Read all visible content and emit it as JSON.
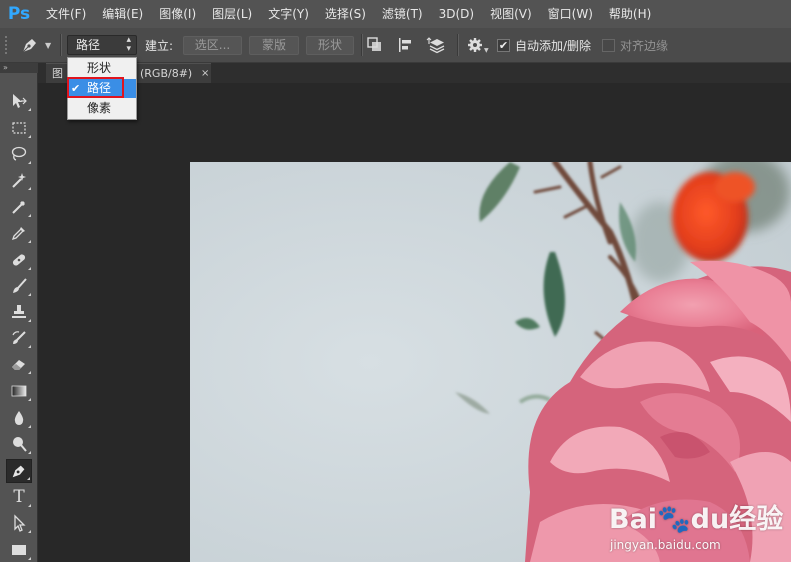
{
  "app": {
    "logo": "Ps"
  },
  "menu": [
    "文件(F)",
    "编辑(E)",
    "图像(I)",
    "图层(L)",
    "文字(Y)",
    "选择(S)",
    "滤镜(T)",
    "3D(D)",
    "视图(V)",
    "窗口(W)",
    "帮助(H)"
  ],
  "options": {
    "mode_value": "路径",
    "build_label": "建立:",
    "selection_btn": "选区...",
    "mask_btn": "蒙版",
    "shape_btn": "形状",
    "auto_add_delete": "自动添加/删除",
    "auto_add_delete_checked": true,
    "align_edges": "对齐边缘",
    "align_edges_checked": false
  },
  "dropdown": {
    "options": [
      "形状",
      "路径",
      "像素"
    ],
    "selected": "路径",
    "check": "✔"
  },
  "document_tab": {
    "title_left": "图",
    "title_right": "(RGB/8#)",
    "close": "×"
  },
  "toolbox": {
    "header": "»",
    "tools": [
      "move-icon",
      "marquee-icon",
      "lasso-icon",
      "magic-wand-icon",
      "crop-icon",
      "eyedropper-icon",
      "healing-brush-icon",
      "brush-icon",
      "clone-stamp-icon",
      "history-brush-icon",
      "eraser-icon",
      "gradient-icon",
      "blur-icon",
      "dodge-icon",
      "pen-icon",
      "type-icon",
      "path-selection-icon",
      "rectangle-icon"
    ],
    "active_tool": "pen-icon",
    "type_tool_glyph": "T"
  },
  "watermark": {
    "brand": "Bai🐾du经验",
    "url": "jingyan.baidu.com"
  },
  "colors": {
    "accent_blue": "#31a8ff",
    "highlight_red": "#e0141e",
    "menu_bg": "#535353"
  }
}
